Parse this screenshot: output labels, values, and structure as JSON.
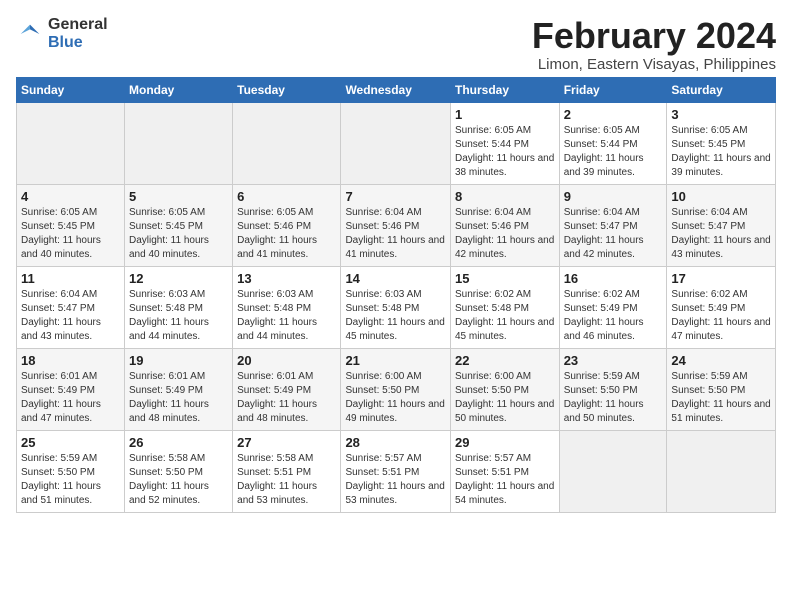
{
  "logo": {
    "general": "General",
    "blue": "Blue"
  },
  "title": {
    "month": "February 2024",
    "location": "Limon, Eastern Visayas, Philippines"
  },
  "headers": [
    "Sunday",
    "Monday",
    "Tuesday",
    "Wednesday",
    "Thursday",
    "Friday",
    "Saturday"
  ],
  "weeks": [
    [
      {
        "day": "",
        "info": ""
      },
      {
        "day": "",
        "info": ""
      },
      {
        "day": "",
        "info": ""
      },
      {
        "day": "",
        "info": ""
      },
      {
        "day": "1",
        "info": "Sunrise: 6:05 AM\nSunset: 5:44 PM\nDaylight: 11 hours and 38 minutes."
      },
      {
        "day": "2",
        "info": "Sunrise: 6:05 AM\nSunset: 5:44 PM\nDaylight: 11 hours and 39 minutes."
      },
      {
        "day": "3",
        "info": "Sunrise: 6:05 AM\nSunset: 5:45 PM\nDaylight: 11 hours and 39 minutes."
      }
    ],
    [
      {
        "day": "4",
        "info": "Sunrise: 6:05 AM\nSunset: 5:45 PM\nDaylight: 11 hours and 40 minutes."
      },
      {
        "day": "5",
        "info": "Sunrise: 6:05 AM\nSunset: 5:45 PM\nDaylight: 11 hours and 40 minutes."
      },
      {
        "day": "6",
        "info": "Sunrise: 6:05 AM\nSunset: 5:46 PM\nDaylight: 11 hours and 41 minutes."
      },
      {
        "day": "7",
        "info": "Sunrise: 6:04 AM\nSunset: 5:46 PM\nDaylight: 11 hours and 41 minutes."
      },
      {
        "day": "8",
        "info": "Sunrise: 6:04 AM\nSunset: 5:46 PM\nDaylight: 11 hours and 42 minutes."
      },
      {
        "day": "9",
        "info": "Sunrise: 6:04 AM\nSunset: 5:47 PM\nDaylight: 11 hours and 42 minutes."
      },
      {
        "day": "10",
        "info": "Sunrise: 6:04 AM\nSunset: 5:47 PM\nDaylight: 11 hours and 43 minutes."
      }
    ],
    [
      {
        "day": "11",
        "info": "Sunrise: 6:04 AM\nSunset: 5:47 PM\nDaylight: 11 hours and 43 minutes."
      },
      {
        "day": "12",
        "info": "Sunrise: 6:03 AM\nSunset: 5:48 PM\nDaylight: 11 hours and 44 minutes."
      },
      {
        "day": "13",
        "info": "Sunrise: 6:03 AM\nSunset: 5:48 PM\nDaylight: 11 hours and 44 minutes."
      },
      {
        "day": "14",
        "info": "Sunrise: 6:03 AM\nSunset: 5:48 PM\nDaylight: 11 hours and 45 minutes."
      },
      {
        "day": "15",
        "info": "Sunrise: 6:02 AM\nSunset: 5:48 PM\nDaylight: 11 hours and 45 minutes."
      },
      {
        "day": "16",
        "info": "Sunrise: 6:02 AM\nSunset: 5:49 PM\nDaylight: 11 hours and 46 minutes."
      },
      {
        "day": "17",
        "info": "Sunrise: 6:02 AM\nSunset: 5:49 PM\nDaylight: 11 hours and 47 minutes."
      }
    ],
    [
      {
        "day": "18",
        "info": "Sunrise: 6:01 AM\nSunset: 5:49 PM\nDaylight: 11 hours and 47 minutes."
      },
      {
        "day": "19",
        "info": "Sunrise: 6:01 AM\nSunset: 5:49 PM\nDaylight: 11 hours and 48 minutes."
      },
      {
        "day": "20",
        "info": "Sunrise: 6:01 AM\nSunset: 5:49 PM\nDaylight: 11 hours and 48 minutes."
      },
      {
        "day": "21",
        "info": "Sunrise: 6:00 AM\nSunset: 5:50 PM\nDaylight: 11 hours and 49 minutes."
      },
      {
        "day": "22",
        "info": "Sunrise: 6:00 AM\nSunset: 5:50 PM\nDaylight: 11 hours and 50 minutes."
      },
      {
        "day": "23",
        "info": "Sunrise: 5:59 AM\nSunset: 5:50 PM\nDaylight: 11 hours and 50 minutes."
      },
      {
        "day": "24",
        "info": "Sunrise: 5:59 AM\nSunset: 5:50 PM\nDaylight: 11 hours and 51 minutes."
      }
    ],
    [
      {
        "day": "25",
        "info": "Sunrise: 5:59 AM\nSunset: 5:50 PM\nDaylight: 11 hours and 51 minutes."
      },
      {
        "day": "26",
        "info": "Sunrise: 5:58 AM\nSunset: 5:50 PM\nDaylight: 11 hours and 52 minutes."
      },
      {
        "day": "27",
        "info": "Sunrise: 5:58 AM\nSunset: 5:51 PM\nDaylight: 11 hours and 53 minutes."
      },
      {
        "day": "28",
        "info": "Sunrise: 5:57 AM\nSunset: 5:51 PM\nDaylight: 11 hours and 53 minutes."
      },
      {
        "day": "29",
        "info": "Sunrise: 5:57 AM\nSunset: 5:51 PM\nDaylight: 11 hours and 54 minutes."
      },
      {
        "day": "",
        "info": ""
      },
      {
        "day": "",
        "info": ""
      }
    ]
  ]
}
